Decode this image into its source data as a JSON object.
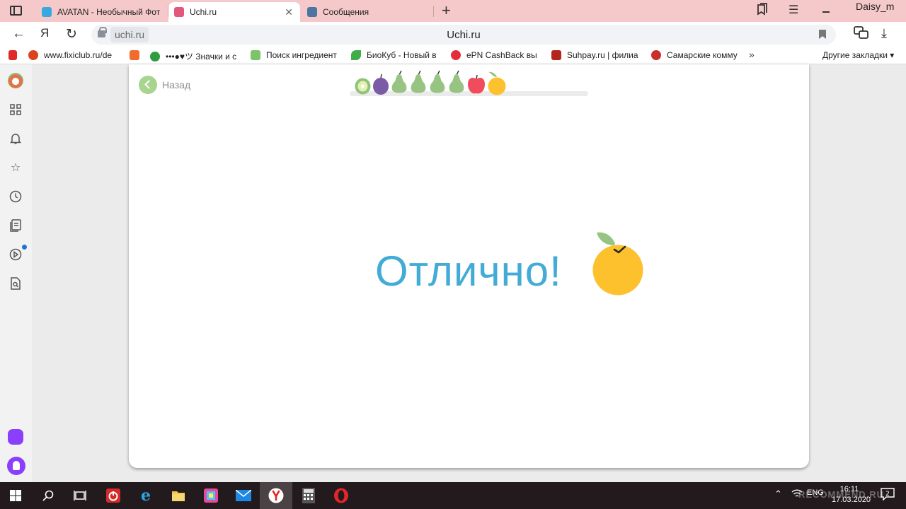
{
  "tabs": [
    {
      "title": "AVATAN - Необычный Фот",
      "favicon_color": "#3aa8e0"
    },
    {
      "title": "Uchi.ru",
      "favicon_color": "#e2577a"
    },
    {
      "title": "Сообщения",
      "favicon_color": "#4c75a3"
    }
  ],
  "window": {
    "user_label": "Daisy_m"
  },
  "address": {
    "domain": "uchi.ru",
    "page_title": "Uchi.ru"
  },
  "bookmarks": {
    "items": [
      {
        "label": "www.fixiclub.ru/de",
        "favicon_color": "#d9441c"
      },
      {
        "label": "",
        "favicon_color": "#f06b2c"
      },
      {
        "label": "•••●♥ツ Значки и с",
        "favicon_color": "#2e9c3f"
      },
      {
        "label": "Поиск ингредиент",
        "favicon_color": "#7cc36a"
      },
      {
        "label": "БиоКуб - Новый в",
        "favicon_color": "#3fae49"
      },
      {
        "label": "ePN CashBack вы",
        "favicon_color": "#e42d3b"
      },
      {
        "label": "Suhpay.ru | филиа",
        "favicon_color": "#b3261e"
      },
      {
        "label": "Самарские комму",
        "favicon_color": "#c9302c"
      }
    ],
    "more": "»",
    "other": "Другие закладки ▾"
  },
  "page": {
    "back_label": "Назад",
    "result_text": "Отлично!",
    "progress_fruits": [
      "kiwi",
      "plum",
      "pear",
      "pear",
      "pear",
      "pear",
      "apple",
      "orange"
    ]
  },
  "taskbar": {
    "lang": "ENG",
    "time": "16:11",
    "date": "17.03.2020",
    "notification_count": "2",
    "watermark": "RECOMMEND.RU"
  },
  "colors": {
    "accent_text": "#43acd6",
    "back_button": "#a9d48f",
    "tabbar_bg": "#f5c9c9",
    "orange": "#fcc12d",
    "leaf": "#98c483"
  }
}
